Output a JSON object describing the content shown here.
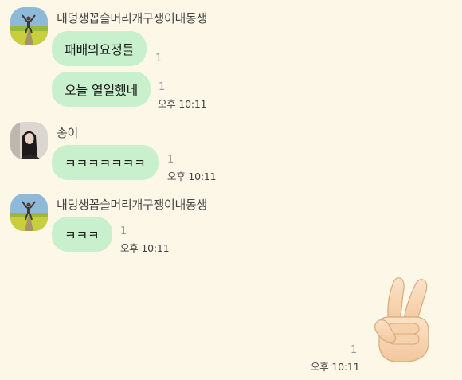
{
  "messages": [
    {
      "sender": "내덩생꼽슬머리개구쟁이내동생",
      "avatar": "field-photo",
      "bubbles": [
        {
          "text": "패배의요정들",
          "unread": "1"
        },
        {
          "text": "오늘 열일했네",
          "unread": "1",
          "time": "오후 10:11"
        }
      ]
    },
    {
      "sender": "송이",
      "avatar": "girl-photo",
      "bubbles": [
        {
          "text": "ㅋㅋㅋㅋㅋㅋㅋ",
          "unread": "1",
          "time": "오후 10:11"
        }
      ]
    },
    {
      "sender": "내덩생꼽슬머리개구쟁이내동생",
      "avatar": "field-photo",
      "bubbles": [
        {
          "text": "ㅋㅋㅋ",
          "unread": "1",
          "time": "오후 10:11"
        }
      ]
    }
  ],
  "my_message": {
    "emoji": "victory-hand-emoji",
    "unread": "1",
    "time": "오후 10:11"
  }
}
